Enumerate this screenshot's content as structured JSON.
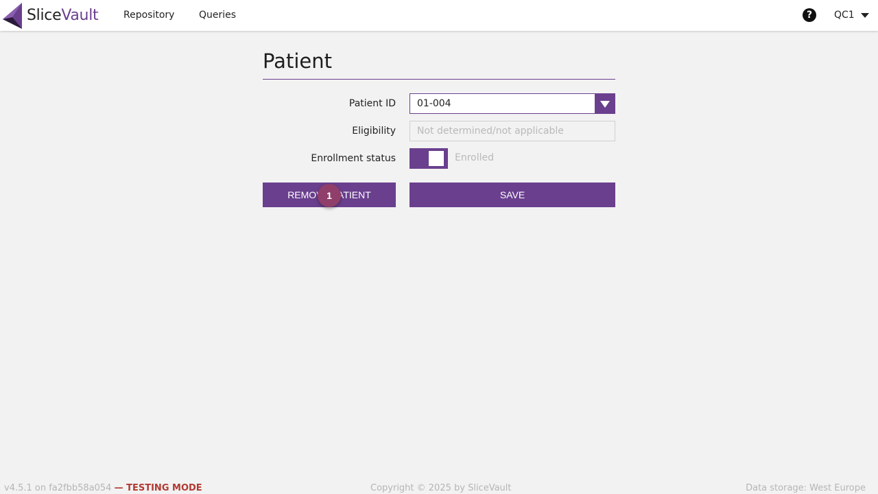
{
  "header": {
    "logo": {
      "part1": "Slice",
      "part2": "Vault"
    },
    "nav": [
      {
        "label": "Repository"
      },
      {
        "label": "Queries"
      }
    ],
    "help_icon": "question-circle-icon",
    "user": "QC1",
    "user_caret_icon": "caret-down-icon"
  },
  "page": {
    "title": "Patient",
    "fields": {
      "patient_id": {
        "label": "Patient ID",
        "value": "01-004"
      },
      "eligibility": {
        "label": "Eligibility",
        "placeholder": "Not determined/not applicable"
      },
      "enrollment": {
        "label": "Enrollment status",
        "state_label": "Enrolled",
        "on": true
      }
    },
    "buttons": {
      "remove": "REMOVE PATIENT",
      "save": "SAVE"
    },
    "step_badge": "1"
  },
  "footer": {
    "version": "v4.5.1 on fa2fbb58a054",
    "mode": "— TESTING MODE",
    "copyright": "Copyright © 2025 by SliceVault",
    "storage": "Data storage: West Europe"
  },
  "colors": {
    "accent": "#6a3f8e",
    "badge": "#8f3f6a",
    "background": "#f2f2f2",
    "testing_mode": "#b03a32"
  }
}
